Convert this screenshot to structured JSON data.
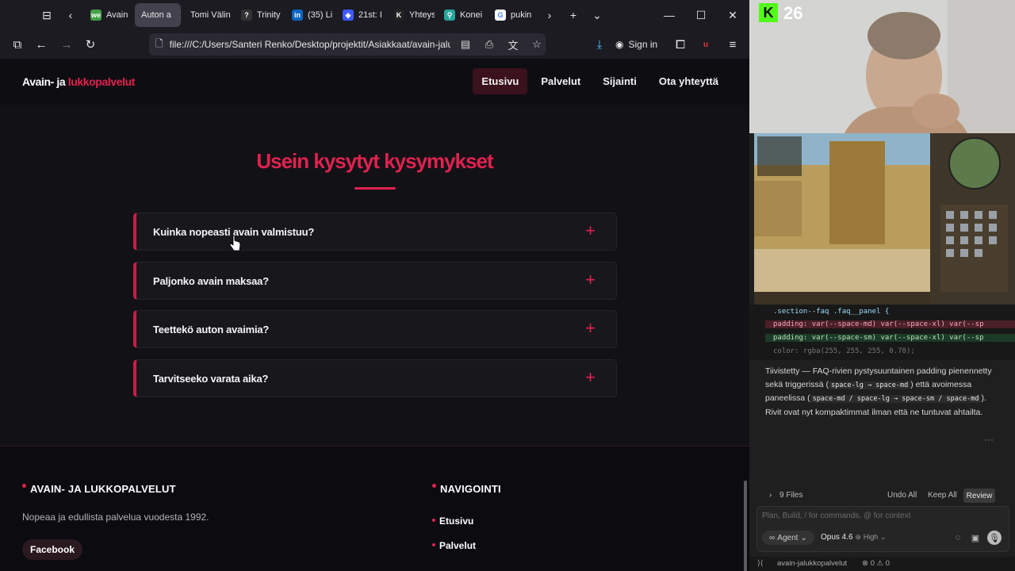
{
  "browser": {
    "tabs": [
      {
        "label": "Avain",
        "fav": "we",
        "color": "#43a047"
      },
      {
        "label": "Auton a",
        "fav": "",
        "color": "#888888",
        "active": true
      },
      {
        "label": "Tomi Välin",
        "fav": "",
        "color": "#555555"
      },
      {
        "label": "Trinity",
        "fav": "?",
        "color": "#333333"
      },
      {
        "label": "(35) Li",
        "fav": "in",
        "color": "#0a66c2"
      },
      {
        "label": "21st: I",
        "fav": "◈",
        "color": "#3d5afe"
      },
      {
        "label": "Yhteys",
        "fav": "K",
        "color": "#222222"
      },
      {
        "label": "Konei",
        "fav": "⚲",
        "color": "#26a69a"
      },
      {
        "label": "pukin",
        "fav": "G",
        "color": "#ffffff"
      }
    ],
    "url": "file:///C:/Users/Santeri Renko/Desktop/projektit/Asiakkaat/avain-jaluk",
    "sign_in": "Sign in"
  },
  "site": {
    "brand_main": "Avain- ja",
    "brand_accent": "lukkopalvelut",
    "nav": [
      "Etusivu",
      "Palvelut",
      "Sijainti",
      "Ota yhteyttä"
    ],
    "faq_title": "Usein kysytyt kysymykset",
    "faq": [
      "Kuinka nopeasti avain valmistuu?",
      "Paljonko avain maksaa?",
      "Teettekö auton avaimia?",
      "Tarvitseeko varata aika?"
    ],
    "footer": {
      "company": "AVAIN- JA LUKKOPALVELUT",
      "tagline": "Nopeaa ja edullista palvelua vuodesta 1992.",
      "facebook": "Facebook",
      "nav_heading": "NAVIGOINTI",
      "nav_links": [
        "Etusivu",
        "Palvelut"
      ]
    }
  },
  "stream": {
    "viewer_count": "26"
  },
  "editor": {
    "code_line_1": ".section--faq .faq__panel {",
    "code_line_2": "padding: var(--space-md) var(--space-xl) var(--sp",
    "code_line_3": "padding: var(--space-sm) var(--space-xl) var(--sp",
    "code_line_4": "color: rgba(255, 255, 255, 0.78);",
    "chat_1": "Tiivistetty — FAQ-rivien pystysuuntainen padding pienennetty sekä triggerissä (",
    "chat_code_1": "space-lg → space-md",
    "chat_2": ") että avoimessa paneelissa (",
    "chat_code_2": "space-md / space-lg → space-sm / space-md",
    "chat_3": "). Rivit ovat nyt kompaktimmat ilman että ne tuntuvat ahtailta.",
    "files": "9 Files",
    "undo_all": "Undo All",
    "keep_all": "Keep All",
    "review": "Review",
    "input_placeholder": "Plan, Build, / for commands, @ for context",
    "agent": "Agent",
    "model": "Opus 4.6",
    "effort": "High",
    "status_project": "avain-jalukkopalvelut",
    "status_counts": "⊗ 0 ⚠ 0"
  }
}
